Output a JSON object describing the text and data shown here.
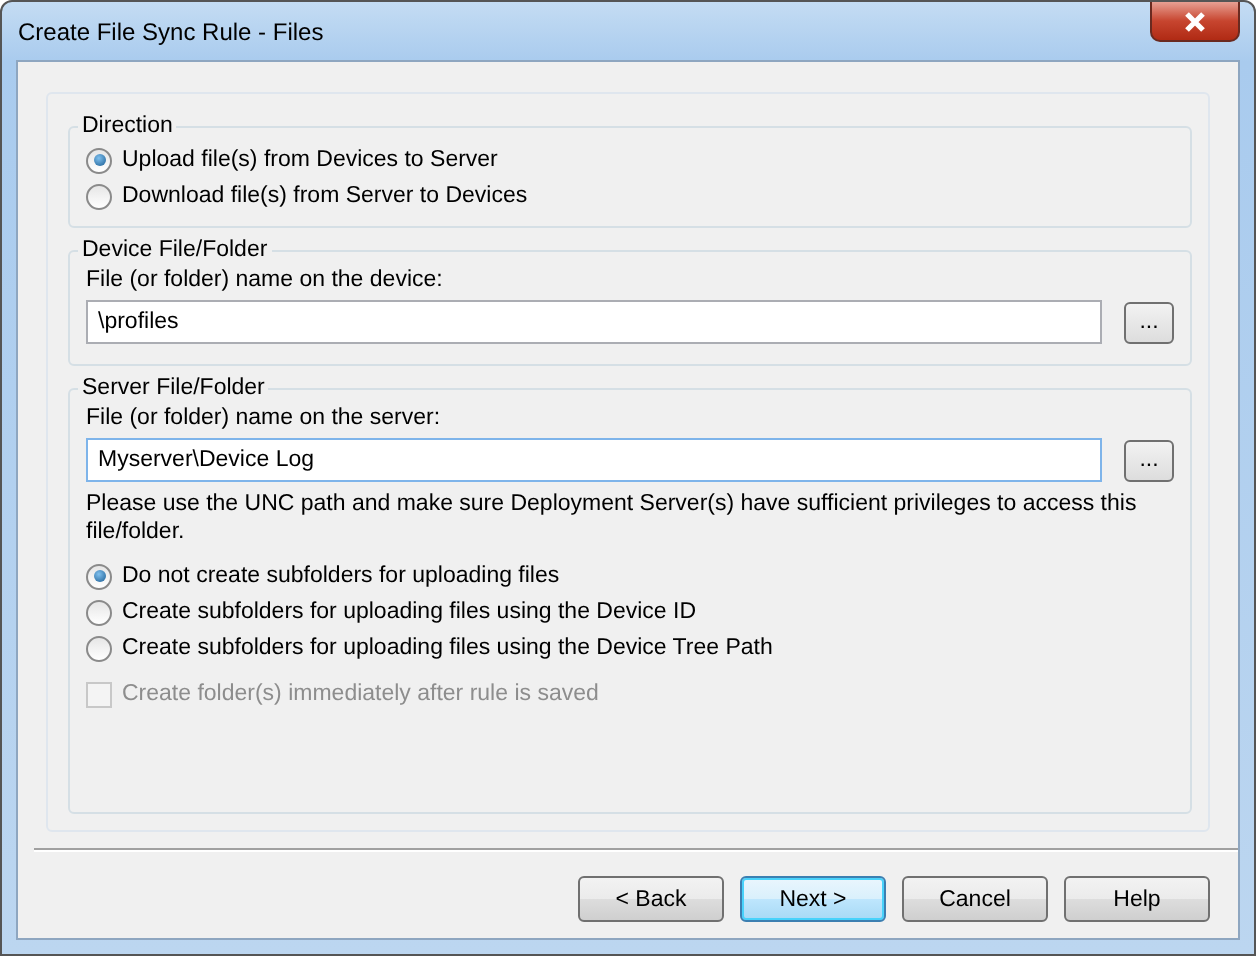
{
  "window": {
    "title": "Create File Sync Rule - Files"
  },
  "direction": {
    "label": "Direction",
    "options": [
      {
        "label": "Upload file(s) from Devices to Server",
        "selected": true
      },
      {
        "label": "Download file(s) from Server to Devices",
        "selected": false
      }
    ]
  },
  "device_folder": {
    "label": "Device File/Folder",
    "field_label": "File (or folder) name on the device:",
    "value": "\\profiles",
    "browse": "..."
  },
  "server_folder": {
    "label": "Server File/Folder",
    "field_label": "File (or folder) name on the server:",
    "value": "Myserver\\Device Log",
    "browse": "...",
    "note": "Please use the UNC path and make sure Deployment Server(s) have sufficient privileges to access this file/folder.",
    "options": [
      {
        "label": "Do not create subfolders for uploading files",
        "selected": true
      },
      {
        "label": "Create subfolders for uploading files using the Device ID",
        "selected": false
      },
      {
        "label": "Create subfolders for uploading files using the Device Tree Path",
        "selected": false
      }
    ],
    "create_now": {
      "label": "Create folder(s) immediately after rule is saved",
      "checked": false,
      "disabled": true
    }
  },
  "buttons": [
    {
      "label": "< Back",
      "default": false
    },
    {
      "label": "Next >",
      "default": true
    },
    {
      "label": "Cancel",
      "default": false
    },
    {
      "label": "Help",
      "default": false
    }
  ]
}
